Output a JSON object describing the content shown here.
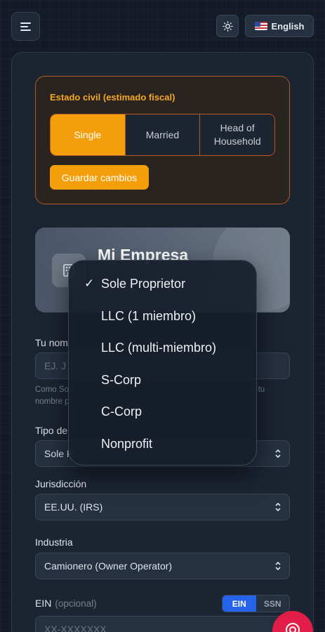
{
  "header": {
    "language_label": "English"
  },
  "marital": {
    "title": "Estado civil (estimado fiscal)",
    "options": [
      "Single",
      "Married",
      "Head of\nHousehold"
    ],
    "save_label": "Guardar cambios"
  },
  "company": {
    "name": "Mi Empresa"
  },
  "fields": {
    "name_label": "Tu nom",
    "name_placeholder": "EJ. J",
    "help_left": "Como So",
    "help_right": "n tu",
    "help_line2": "nombre p",
    "type_label": "Tipo de",
    "type_value": "Sole P",
    "jurisdiction_label": "Jurisdicción",
    "jurisdiction_value": "EE.UU. (IRS)",
    "industry_label": "Industria",
    "industry_value": "Camionero (Owner Operator)",
    "ein_label": "EIN",
    "ein_optional": "(opcional)",
    "ein_toggle": [
      "EIN",
      "SSN"
    ],
    "ein_placeholder": "XX-XXXXXXX"
  },
  "dropdown": {
    "selected_index": 0,
    "items": [
      "Sole Proprietor",
      "LLC (1 miembro)",
      "LLC (multi-miembro)",
      "S-Corp",
      "C-Corp",
      "Nonprofit"
    ],
    "check": "✓"
  },
  "colors": {
    "accent": "#f59e0b",
    "primary": "#2563eb",
    "help": "#e11d48"
  }
}
